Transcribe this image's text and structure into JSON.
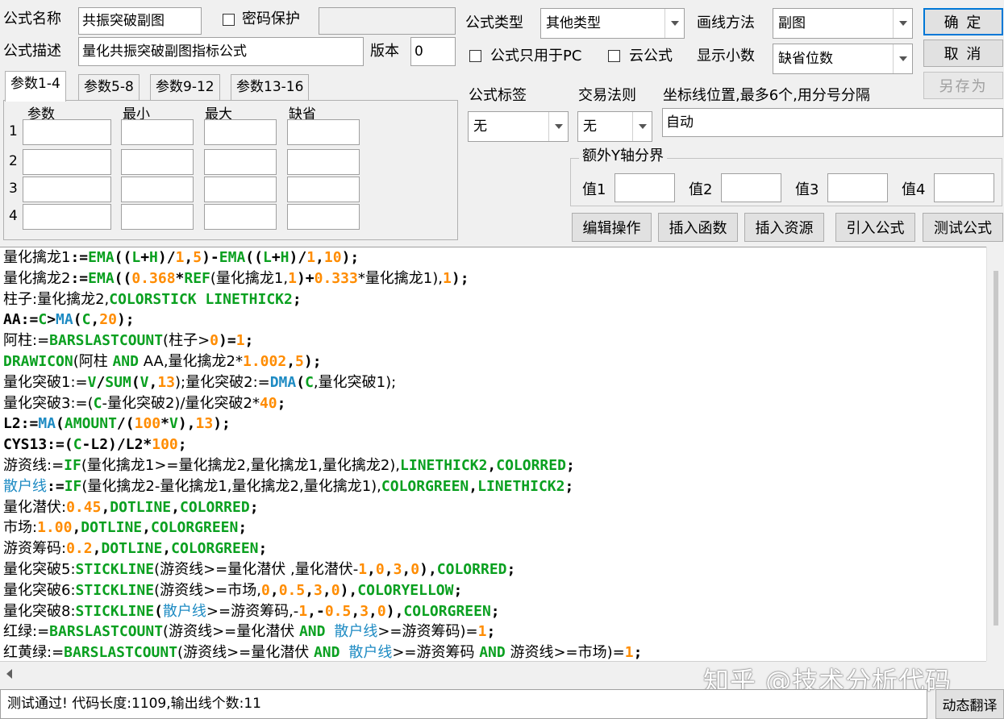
{
  "form": {
    "name_label": "公式名称",
    "name_value": "共振突破副图",
    "password_label": "密码保护",
    "password_value": "",
    "desc_label": "公式描述",
    "desc_value": "量化共振突破副图指标公式",
    "version_label": "版本",
    "version_value": "0",
    "type_label": "公式类型",
    "type_value": "其他类型",
    "draw_label": "画线方法",
    "draw_value": "副图",
    "pc_only_label": "公式只用于PC",
    "cloud_label": "云公式",
    "decimals_label": "显示小数",
    "decimals_value": "缺省位数",
    "tag_label": "公式标签",
    "tag_value": "无",
    "rule_label": "交易法则",
    "rule_value": "无",
    "axis_label": "坐标线位置,最多6个,用分号分隔",
    "axis_value": "自动",
    "extra_y_label": "额外Y轴分界",
    "val1_label": "值1",
    "val2_label": "值2",
    "val3_label": "值3",
    "val4_label": "值4"
  },
  "buttons": {
    "ok": "确  定",
    "cancel": "取  消",
    "save_as": "另存为",
    "edit_ops": "编辑操作",
    "insert_func": "插入函数",
    "insert_res": "插入资源",
    "import_formula": "引入公式",
    "test_formula": "测试公式",
    "translate": "动态翻译"
  },
  "tabs": [
    "参数1-4",
    "参数5-8",
    "参数9-12",
    "参数13-16"
  ],
  "params": {
    "headers": [
      "参数",
      "最小",
      "最大",
      "缺省"
    ],
    "rows": [
      "1",
      "2",
      "3",
      "4"
    ]
  },
  "code_lines": [
    [
      [
        "量化擒龙1",
        "d"
      ],
      [
        ":=",
        "d"
      ],
      [
        "EMA",
        "f"
      ],
      [
        "((",
        "d"
      ],
      [
        "L",
        "f"
      ],
      [
        "+",
        "d"
      ],
      [
        "H",
        "f"
      ],
      [
        ")/",
        "d"
      ],
      [
        "1",
        "n"
      ],
      [
        ",",
        "d"
      ],
      [
        "5",
        "n"
      ],
      [
        ")-",
        "d"
      ],
      [
        "EMA",
        "f"
      ],
      [
        "((",
        "d"
      ],
      [
        "L",
        "f"
      ],
      [
        "+",
        "d"
      ],
      [
        "H",
        "f"
      ],
      [
        ")/",
        "d"
      ],
      [
        "1",
        "n"
      ],
      [
        ",",
        "d"
      ],
      [
        "10",
        "n"
      ],
      [
        ");",
        "d"
      ]
    ],
    [
      [
        "量化擒龙2",
        "d"
      ],
      [
        ":=",
        "d"
      ],
      [
        "EMA",
        "f"
      ],
      [
        "((",
        "d"
      ],
      [
        "0.368",
        "n"
      ],
      [
        "*",
        "d"
      ],
      [
        "REF",
        "f"
      ],
      [
        "(量化擒龙1,",
        "d"
      ],
      [
        "1",
        "n"
      ],
      [
        ")+",
        "d"
      ],
      [
        "0.333",
        "n"
      ],
      [
        "*量化擒龙1),",
        "d"
      ],
      [
        "1",
        "n"
      ],
      [
        ");",
        "d"
      ]
    ],
    [
      [
        "柱子:量化擒龙2,",
        "d"
      ],
      [
        "COLORSTICK LINETHICK2",
        "f"
      ],
      [
        ";",
        "d"
      ]
    ],
    [
      [
        "AA:=",
        "d"
      ],
      [
        "C",
        "f"
      ],
      [
        ">",
        "d"
      ],
      [
        "MA",
        "m"
      ],
      [
        "(",
        "d"
      ],
      [
        "C",
        "f"
      ],
      [
        ",",
        "d"
      ],
      [
        "20",
        "n"
      ],
      [
        ");",
        "d"
      ]
    ],
    [
      [
        "阿柱:=",
        "d"
      ],
      [
        "BARSLASTCOUNT",
        "f"
      ],
      [
        "(柱子>",
        "d"
      ],
      [
        "0",
        "n"
      ],
      [
        ")=",
        "d"
      ],
      [
        "1",
        "n"
      ],
      [
        ";",
        "d"
      ]
    ],
    [
      [
        "DRAWICON",
        "f"
      ],
      [
        "(阿柱 ",
        "d"
      ],
      [
        "AND",
        "f"
      ],
      [
        " AA,量化擒龙2*",
        "d"
      ],
      [
        "1.002",
        "n"
      ],
      [
        ",",
        "d"
      ],
      [
        "5",
        "n"
      ],
      [
        ");",
        "d"
      ]
    ],
    [
      [
        "量化突破1:=",
        "d"
      ],
      [
        "V",
        "f"
      ],
      [
        "/",
        "d"
      ],
      [
        "SUM",
        "f"
      ],
      [
        "(",
        "d"
      ],
      [
        "V",
        "f"
      ],
      [
        ",",
        "d"
      ],
      [
        "13",
        "n"
      ],
      [
        ");量化突破2:=",
        "d"
      ],
      [
        "DMA",
        "m"
      ],
      [
        "(",
        "d"
      ],
      [
        "C",
        "f"
      ],
      [
        ",量化突破1);",
        "d"
      ]
    ],
    [
      [
        "量化突破3:=(",
        "d"
      ],
      [
        "C",
        "f"
      ],
      [
        "-量化突破2)/量化突破2*",
        "d"
      ],
      [
        "40",
        "n"
      ],
      [
        ";",
        "d"
      ]
    ],
    [
      [
        "L2:=",
        "d"
      ],
      [
        "MA",
        "m"
      ],
      [
        "(",
        "d"
      ],
      [
        "AMOUNT",
        "f"
      ],
      [
        "/(",
        "d"
      ],
      [
        "100",
        "n"
      ],
      [
        "*",
        "d"
      ],
      [
        "V",
        "f"
      ],
      [
        "),",
        "d"
      ],
      [
        "13",
        "n"
      ],
      [
        ");",
        "d"
      ]
    ],
    [
      [
        "CYS13:=(",
        "d"
      ],
      [
        "C",
        "f"
      ],
      [
        "-L2)/L2*",
        "d"
      ],
      [
        "100",
        "n"
      ],
      [
        ";",
        "d"
      ]
    ],
    [
      [
        "游资线:=",
        "d"
      ],
      [
        "IF",
        "f"
      ],
      [
        "(量化擒龙1>=量化擒龙2,量化擒龙1,量化擒龙2),",
        "d"
      ],
      [
        "LINETHICK2",
        "f"
      ],
      [
        ",",
        "d"
      ],
      [
        "COLORRED",
        "f"
      ],
      [
        ";",
        "d"
      ]
    ],
    [
      [
        "散户线",
        "m"
      ],
      [
        ":=",
        "d"
      ],
      [
        "IF",
        "f"
      ],
      [
        "(量化擒龙2-量化擒龙1,量化擒龙2,量化擒龙1),",
        "d"
      ],
      [
        "COLORGREEN",
        "f"
      ],
      [
        ",",
        "d"
      ],
      [
        "LINETHICK2",
        "f"
      ],
      [
        ";",
        "d"
      ]
    ],
    [
      [
        "量化潜伏:",
        "d"
      ],
      [
        "0.45",
        "n"
      ],
      [
        ",",
        "d"
      ],
      [
        "DOTLINE",
        "f"
      ],
      [
        ",",
        "d"
      ],
      [
        "COLORRED",
        "f"
      ],
      [
        ";",
        "d"
      ]
    ],
    [
      [
        "市场:",
        "d"
      ],
      [
        "1.00",
        "n"
      ],
      [
        ",",
        "d"
      ],
      [
        "DOTLINE",
        "f"
      ],
      [
        ",",
        "d"
      ],
      [
        "COLORGREEN",
        "f"
      ],
      [
        ";",
        "d"
      ]
    ],
    [
      [
        "游资筹码:",
        "d"
      ],
      [
        "0.2",
        "n"
      ],
      [
        ",",
        "d"
      ],
      [
        "DOTLINE",
        "f"
      ],
      [
        ",",
        "d"
      ],
      [
        "COLORGREEN",
        "f"
      ],
      [
        ";",
        "d"
      ]
    ],
    [
      [
        "量化突破5:",
        "d"
      ],
      [
        "STICKLINE",
        "f"
      ],
      [
        "(游资线>=量化潜伏 ,量化潜伏-",
        "d"
      ],
      [
        "1",
        "n"
      ],
      [
        ",",
        "d"
      ],
      [
        "0",
        "n"
      ],
      [
        ",",
        "d"
      ],
      [
        "3",
        "n"
      ],
      [
        ",",
        "d"
      ],
      [
        "0",
        "n"
      ],
      [
        "),",
        "d"
      ],
      [
        "COLORRED",
        "f"
      ],
      [
        ";",
        "d"
      ]
    ],
    [
      [
        "量化突破6:",
        "d"
      ],
      [
        "STICKLINE",
        "f"
      ],
      [
        "(游资线>=市场,",
        "d"
      ],
      [
        "0",
        "n"
      ],
      [
        ",",
        "d"
      ],
      [
        "0.5",
        "n"
      ],
      [
        ",",
        "d"
      ],
      [
        "3",
        "n"
      ],
      [
        ",",
        "d"
      ],
      [
        "0",
        "n"
      ],
      [
        "),",
        "d"
      ],
      [
        "COLORYELLOW",
        "f"
      ],
      [
        ";",
        "d"
      ]
    ],
    [
      [
        "量化突破8:",
        "d"
      ],
      [
        "STICKLINE",
        "f"
      ],
      [
        "(",
        "d"
      ],
      [
        "散户线",
        "m"
      ],
      [
        ">=游资筹码,-",
        "d"
      ],
      [
        "1",
        "n"
      ],
      [
        ",-",
        "d"
      ],
      [
        "0.5",
        "n"
      ],
      [
        ",",
        "d"
      ],
      [
        "3",
        "n"
      ],
      [
        ",",
        "d"
      ],
      [
        "0",
        "n"
      ],
      [
        "),",
        "d"
      ],
      [
        "COLORGREEN",
        "f"
      ],
      [
        ";",
        "d"
      ]
    ],
    [
      [
        "红绿:=",
        "d"
      ],
      [
        "BARSLASTCOUNT",
        "f"
      ],
      [
        "(游资线>=量化潜伏 ",
        "d"
      ],
      [
        "AND",
        "f"
      ],
      [
        " ",
        "d"
      ],
      [
        "散户线",
        "m"
      ],
      [
        ">=游资筹码)=",
        "d"
      ],
      [
        "1",
        "n"
      ],
      [
        ";",
        "d"
      ]
    ],
    [
      [
        "红黄绿:=",
        "d"
      ],
      [
        "BARSLASTCOUNT",
        "f"
      ],
      [
        "(游资线>=量化潜伏 ",
        "d"
      ],
      [
        "AND",
        "f"
      ],
      [
        " ",
        "d"
      ],
      [
        "散户线",
        "m"
      ],
      [
        ">=游资筹码 ",
        "d"
      ],
      [
        "AND",
        "f"
      ],
      [
        " 游资线>=市场)=",
        "d"
      ],
      [
        "1",
        "n"
      ],
      [
        ";",
        "d"
      ]
    ]
  ],
  "status": "测试通过! 代码长度:1109,输出线个数:11",
  "watermark": "知乎 @技术分析代码",
  "colors": {
    "keyword": "#0aa020",
    "number": "#ff8c00",
    "macro": "#1e8bc3",
    "default": "#000000"
  }
}
